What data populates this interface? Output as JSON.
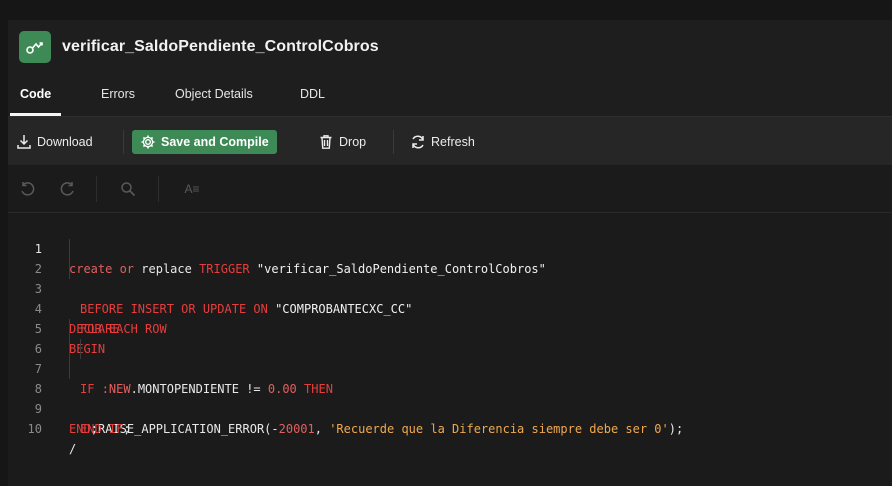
{
  "object": {
    "title": "verificar_SaldoPendiente_ControlCobros",
    "icon": "trigger-icon"
  },
  "tabs": [
    {
      "label": "Code",
      "active": true
    },
    {
      "label": "Errors",
      "active": false
    },
    {
      "label": "Object Details",
      "active": false
    },
    {
      "label": "DDL",
      "active": false
    }
  ],
  "toolbar": {
    "download": "Download",
    "save_compile": "Save and Compile",
    "drop": "Drop",
    "refresh": "Refresh"
  },
  "editor_toolbar": {
    "undo_icon": "undo-icon",
    "redo_icon": "redo-icon",
    "search_icon": "search-icon",
    "format_icon": "format-icon",
    "format_label": "A≡"
  },
  "colors": {
    "accent_green": "#3e8a57",
    "keyword_red": "#e63d3d",
    "string_orange": "#f0a850"
  },
  "code": {
    "line_numbers": [
      "1",
      "2",
      "3",
      "4",
      "5",
      "6",
      "7",
      "8",
      "9",
      "10"
    ],
    "lines": [
      "create or replace TRIGGER \"verificar_SaldoPendiente_ControlCobros\"",
      "  BEFORE INSERT OR UPDATE ON \"COMPROBANTECXC_CC\"",
      "  FOR EACH ROW",
      "DECLARE",
      "BEGIN",
      "  IF :NEW.MONTOPENDIENTE != 0.00 THEN",
      "     RAISE_APPLICATION_ERROR(-20001, 'Recuerde que la Diferencia siempre debe ser 0');",
      "  END IF;",
      "END;",
      "/"
    ]
  }
}
